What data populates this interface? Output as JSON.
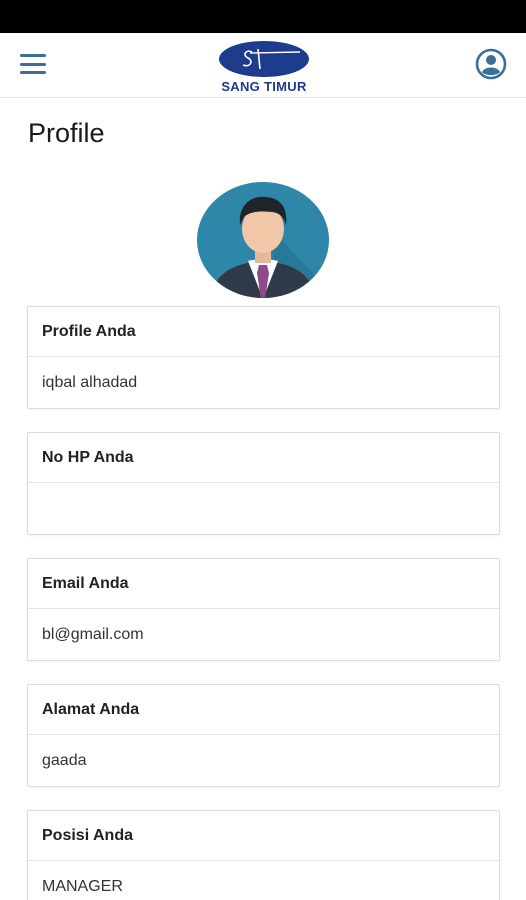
{
  "header": {
    "logo_text": "SANG TIMUR"
  },
  "page_title": "Profile",
  "fields": [
    {
      "label": "Profile Anda",
      "value": "iqbal alhadad"
    },
    {
      "label": "No HP Anda",
      "value": ""
    },
    {
      "label": "Email Anda",
      "value": "bl@gmail.com"
    },
    {
      "label": "Alamat Anda",
      "value": "gaada"
    },
    {
      "label": "Posisi Anda",
      "value": "MANAGER"
    }
  ],
  "colors": {
    "accent": "#3a6f9a",
    "logo_blue": "#1e3c8c",
    "avatar_bg": "#2e86a8"
  },
  "icons": {
    "menu": "hamburger-icon",
    "account": "account-circle-icon",
    "avatar": "user-avatar"
  }
}
